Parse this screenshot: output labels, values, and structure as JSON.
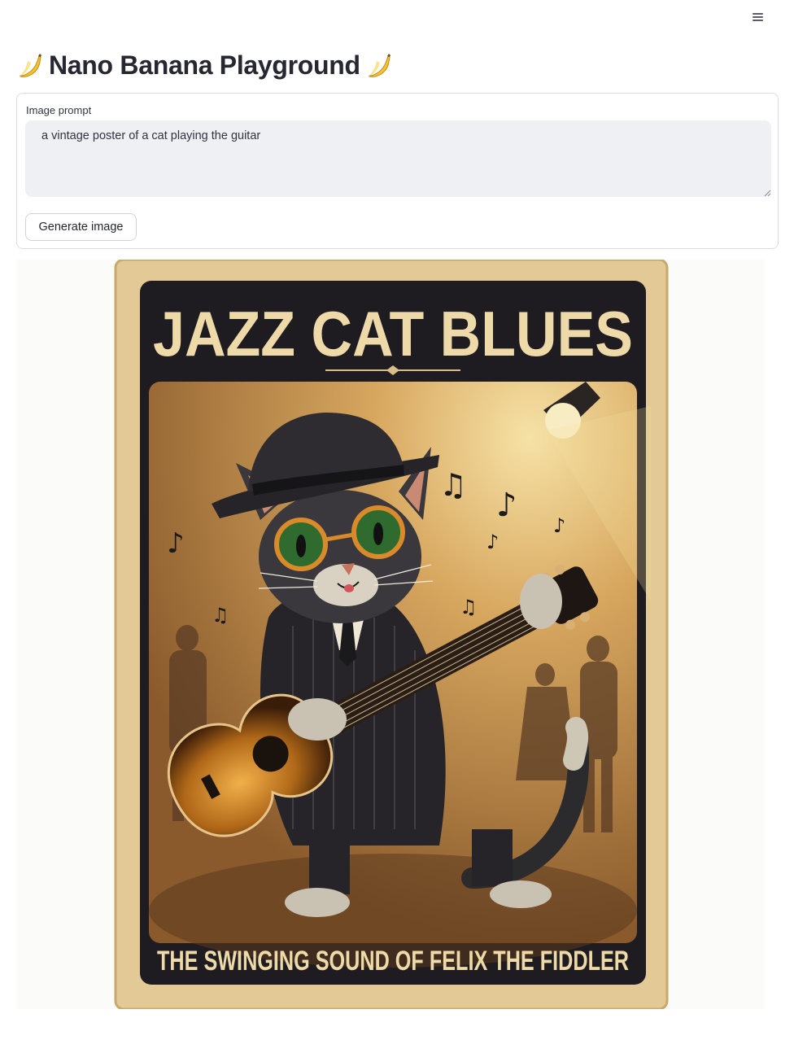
{
  "header": {
    "menu_icon": "hamburger-menu-icon"
  },
  "page": {
    "title": "Nano Banana Playground",
    "title_icon": "banana-emoji"
  },
  "form": {
    "prompt_label": "Image prompt",
    "prompt_value": "a vintage poster of a cat playing the guitar",
    "submit_label": "Generate image"
  },
  "result": {
    "poster_title": "JAZZ CAT BLUES",
    "poster_subtitle": "THE SWINGING SOUND OF FELIX THE FIDDLER",
    "colors": {
      "paper": "#e2c995",
      "frame": "#1f1c21",
      "sky": "#c98f4a",
      "text": "#eed9a8"
    }
  }
}
